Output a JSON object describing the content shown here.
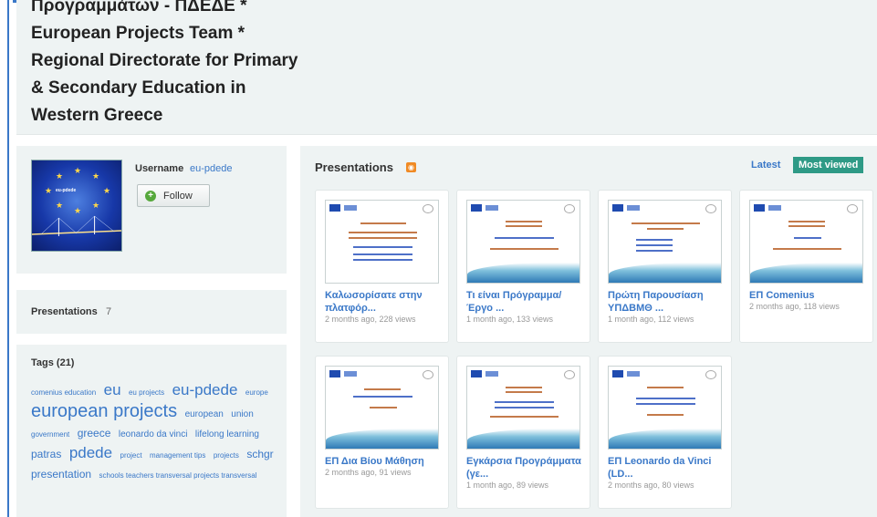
{
  "header": {
    "title_lines": [
      "Προγραμμάτων - ΠΔΕΔΕ *",
      "European Projects Team *",
      "Regional Directorate for Primary",
      "& Secondary Education in",
      "Western Greece"
    ]
  },
  "profile": {
    "avatar_text": "eu-pdede",
    "username_label": "Username",
    "username_value": "eu-pdede",
    "follow_label": "Follow",
    "follow_icon": "plus-circle-icon"
  },
  "presentations_count": {
    "label": "Presentations",
    "value": "7"
  },
  "tags": {
    "heading": "Tags (21)",
    "items": [
      {
        "text": "comenius education",
        "size": "xs"
      },
      {
        "text": "eu",
        "size": "l"
      },
      {
        "text": "eu projects",
        "size": "xs"
      },
      {
        "text": "eu-pdede",
        "size": "l"
      },
      {
        "text": "europe",
        "size": "xs"
      },
      {
        "text": "european projects",
        "size": "xl"
      },
      {
        "text": "european",
        "size": "s"
      },
      {
        "text": "union",
        "size": "s"
      },
      {
        "text": "government",
        "size": "xs"
      },
      {
        "text": "greece",
        "size": "m"
      },
      {
        "text": "leonardo da vinci",
        "size": "s"
      },
      {
        "text": "lifelong learning",
        "size": "s"
      },
      {
        "text": "patras",
        "size": "m"
      },
      {
        "text": "pdede",
        "size": "l"
      },
      {
        "text": "project",
        "size": "xs"
      },
      {
        "text": "management tips",
        "size": "xs"
      },
      {
        "text": "projects",
        "size": "xs"
      },
      {
        "text": "schgr",
        "size": "m"
      },
      {
        "text": "presentation",
        "size": "m"
      },
      {
        "text": "schools teachers transversal projects transversal",
        "size": "xs"
      }
    ]
  },
  "main": {
    "title": "Presentations",
    "rss_icon": "rss-icon",
    "tab_latest": "Latest",
    "tab_most_viewed": "Most viewed",
    "cards": [
      {
        "title": "Καλωσορίσατε στην πλατφόρ...",
        "meta": "2 months ago, 228 views"
      },
      {
        "title": "Τι είναι Πρόγραμμα/Έργο ...",
        "meta": "1 month ago, 133 views"
      },
      {
        "title": "Πρώτη Παρουσίαση ΥΠΔΒΜΘ ...",
        "meta": "1 month ago, 112 views"
      },
      {
        "title": "ΕΠ Comenius",
        "meta": "2 months ago, 118 views"
      },
      {
        "title": "ΕΠ Δια Βίου Μάθηση",
        "meta": "2 months ago, 91 views"
      },
      {
        "title": "Εγκάρσια Προγράμματα (γε...",
        "meta": "1 month ago, 89 views"
      },
      {
        "title": "ΕΠ Leonardo da Vinci (LD...",
        "meta": "2 months ago, 80 views"
      }
    ]
  }
}
